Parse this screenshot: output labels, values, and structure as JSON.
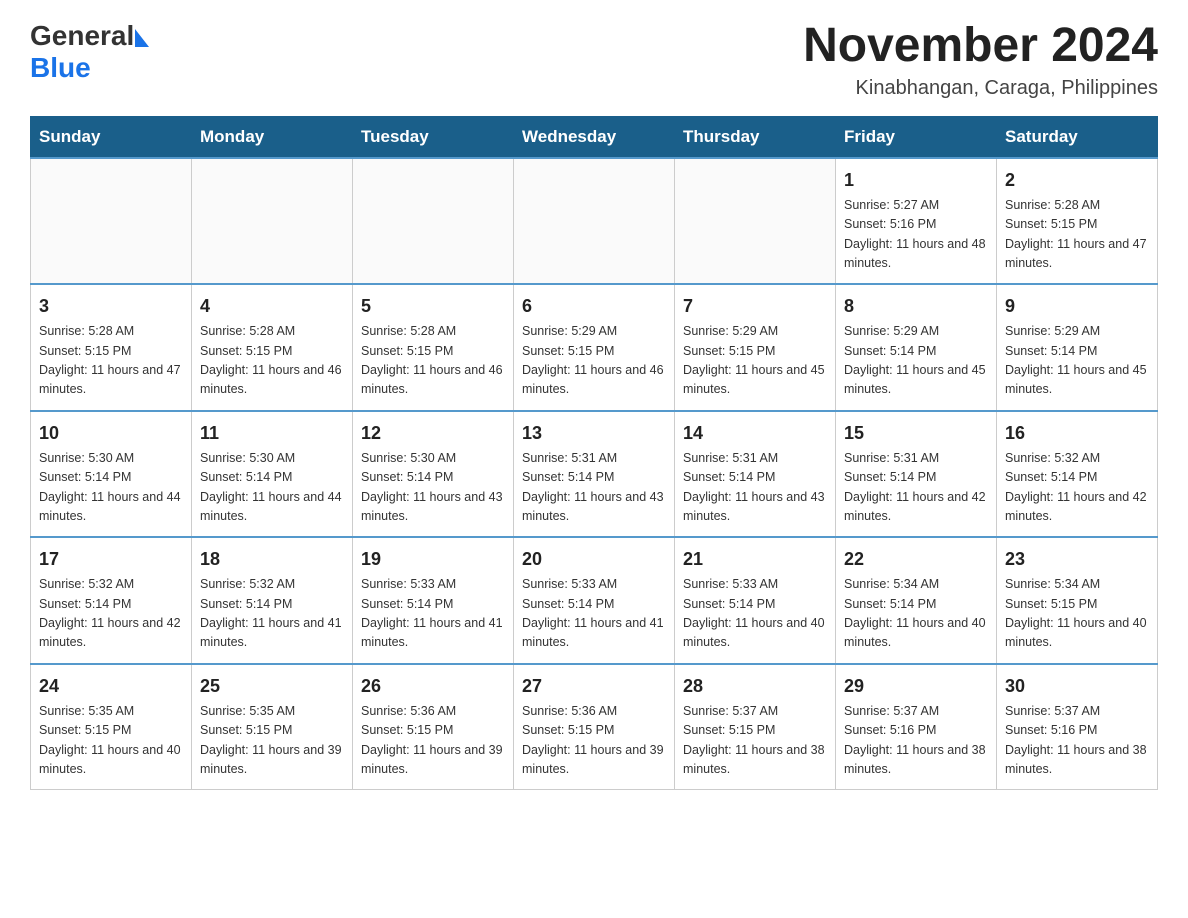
{
  "header": {
    "logo_general": "General",
    "logo_blue": "Blue",
    "month_title": "November 2024",
    "location": "Kinabhangan, Caraga, Philippines"
  },
  "weekdays": [
    "Sunday",
    "Monday",
    "Tuesday",
    "Wednesday",
    "Thursday",
    "Friday",
    "Saturday"
  ],
  "weeks": [
    {
      "days": [
        {
          "number": "",
          "info": ""
        },
        {
          "number": "",
          "info": ""
        },
        {
          "number": "",
          "info": ""
        },
        {
          "number": "",
          "info": ""
        },
        {
          "number": "",
          "info": ""
        },
        {
          "number": "1",
          "info": "Sunrise: 5:27 AM\nSunset: 5:16 PM\nDaylight: 11 hours and 48 minutes."
        },
        {
          "number": "2",
          "info": "Sunrise: 5:28 AM\nSunset: 5:15 PM\nDaylight: 11 hours and 47 minutes."
        }
      ]
    },
    {
      "days": [
        {
          "number": "3",
          "info": "Sunrise: 5:28 AM\nSunset: 5:15 PM\nDaylight: 11 hours and 47 minutes."
        },
        {
          "number": "4",
          "info": "Sunrise: 5:28 AM\nSunset: 5:15 PM\nDaylight: 11 hours and 46 minutes."
        },
        {
          "number": "5",
          "info": "Sunrise: 5:28 AM\nSunset: 5:15 PM\nDaylight: 11 hours and 46 minutes."
        },
        {
          "number": "6",
          "info": "Sunrise: 5:29 AM\nSunset: 5:15 PM\nDaylight: 11 hours and 46 minutes."
        },
        {
          "number": "7",
          "info": "Sunrise: 5:29 AM\nSunset: 5:15 PM\nDaylight: 11 hours and 45 minutes."
        },
        {
          "number": "8",
          "info": "Sunrise: 5:29 AM\nSunset: 5:14 PM\nDaylight: 11 hours and 45 minutes."
        },
        {
          "number": "9",
          "info": "Sunrise: 5:29 AM\nSunset: 5:14 PM\nDaylight: 11 hours and 45 minutes."
        }
      ]
    },
    {
      "days": [
        {
          "number": "10",
          "info": "Sunrise: 5:30 AM\nSunset: 5:14 PM\nDaylight: 11 hours and 44 minutes."
        },
        {
          "number": "11",
          "info": "Sunrise: 5:30 AM\nSunset: 5:14 PM\nDaylight: 11 hours and 44 minutes."
        },
        {
          "number": "12",
          "info": "Sunrise: 5:30 AM\nSunset: 5:14 PM\nDaylight: 11 hours and 43 minutes."
        },
        {
          "number": "13",
          "info": "Sunrise: 5:31 AM\nSunset: 5:14 PM\nDaylight: 11 hours and 43 minutes."
        },
        {
          "number": "14",
          "info": "Sunrise: 5:31 AM\nSunset: 5:14 PM\nDaylight: 11 hours and 43 minutes."
        },
        {
          "number": "15",
          "info": "Sunrise: 5:31 AM\nSunset: 5:14 PM\nDaylight: 11 hours and 42 minutes."
        },
        {
          "number": "16",
          "info": "Sunrise: 5:32 AM\nSunset: 5:14 PM\nDaylight: 11 hours and 42 minutes."
        }
      ]
    },
    {
      "days": [
        {
          "number": "17",
          "info": "Sunrise: 5:32 AM\nSunset: 5:14 PM\nDaylight: 11 hours and 42 minutes."
        },
        {
          "number": "18",
          "info": "Sunrise: 5:32 AM\nSunset: 5:14 PM\nDaylight: 11 hours and 41 minutes."
        },
        {
          "number": "19",
          "info": "Sunrise: 5:33 AM\nSunset: 5:14 PM\nDaylight: 11 hours and 41 minutes."
        },
        {
          "number": "20",
          "info": "Sunrise: 5:33 AM\nSunset: 5:14 PM\nDaylight: 11 hours and 41 minutes."
        },
        {
          "number": "21",
          "info": "Sunrise: 5:33 AM\nSunset: 5:14 PM\nDaylight: 11 hours and 40 minutes."
        },
        {
          "number": "22",
          "info": "Sunrise: 5:34 AM\nSunset: 5:14 PM\nDaylight: 11 hours and 40 minutes."
        },
        {
          "number": "23",
          "info": "Sunrise: 5:34 AM\nSunset: 5:15 PM\nDaylight: 11 hours and 40 minutes."
        }
      ]
    },
    {
      "days": [
        {
          "number": "24",
          "info": "Sunrise: 5:35 AM\nSunset: 5:15 PM\nDaylight: 11 hours and 40 minutes."
        },
        {
          "number": "25",
          "info": "Sunrise: 5:35 AM\nSunset: 5:15 PM\nDaylight: 11 hours and 39 minutes."
        },
        {
          "number": "26",
          "info": "Sunrise: 5:36 AM\nSunset: 5:15 PM\nDaylight: 11 hours and 39 minutes."
        },
        {
          "number": "27",
          "info": "Sunrise: 5:36 AM\nSunset: 5:15 PM\nDaylight: 11 hours and 39 minutes."
        },
        {
          "number": "28",
          "info": "Sunrise: 5:37 AM\nSunset: 5:15 PM\nDaylight: 11 hours and 38 minutes."
        },
        {
          "number": "29",
          "info": "Sunrise: 5:37 AM\nSunset: 5:16 PM\nDaylight: 11 hours and 38 minutes."
        },
        {
          "number": "30",
          "info": "Sunrise: 5:37 AM\nSunset: 5:16 PM\nDaylight: 11 hours and 38 minutes."
        }
      ]
    }
  ]
}
